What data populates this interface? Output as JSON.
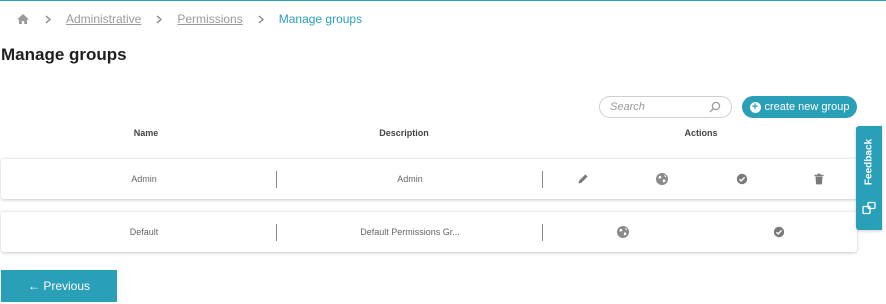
{
  "breadcrumb": {
    "home_icon": "home-icon",
    "items": [
      {
        "label": "Administrative"
      },
      {
        "label": "Permissions"
      }
    ],
    "current": "Manage groups",
    "separator": ">"
  },
  "page": {
    "title": "Manage groups"
  },
  "search": {
    "placeholder": "Search",
    "value": ""
  },
  "create_button": {
    "label": "create new group",
    "icon": "plus-circle-icon"
  },
  "table": {
    "columns": [
      "Name",
      "Description",
      "Actions"
    ],
    "rows": [
      {
        "name": "Admin",
        "description": "Admin",
        "actions": [
          "edit-icon",
          "globe-icon",
          "check-circle-icon",
          "trash-icon"
        ]
      },
      {
        "name": "Default",
        "description": "Default Permissions Gr...",
        "actions": [
          "globe-icon",
          "check-circle-icon"
        ]
      }
    ]
  },
  "pagination": {
    "previous_label": "← Previous"
  },
  "feedback": {
    "label": "Feedback",
    "icon": "feedback-icon"
  },
  "colors": {
    "accent": "#2a9fb8",
    "title": "#1f1f1f",
    "muted": "#9a9a9a",
    "icon_gray": "#7a7a7a"
  }
}
